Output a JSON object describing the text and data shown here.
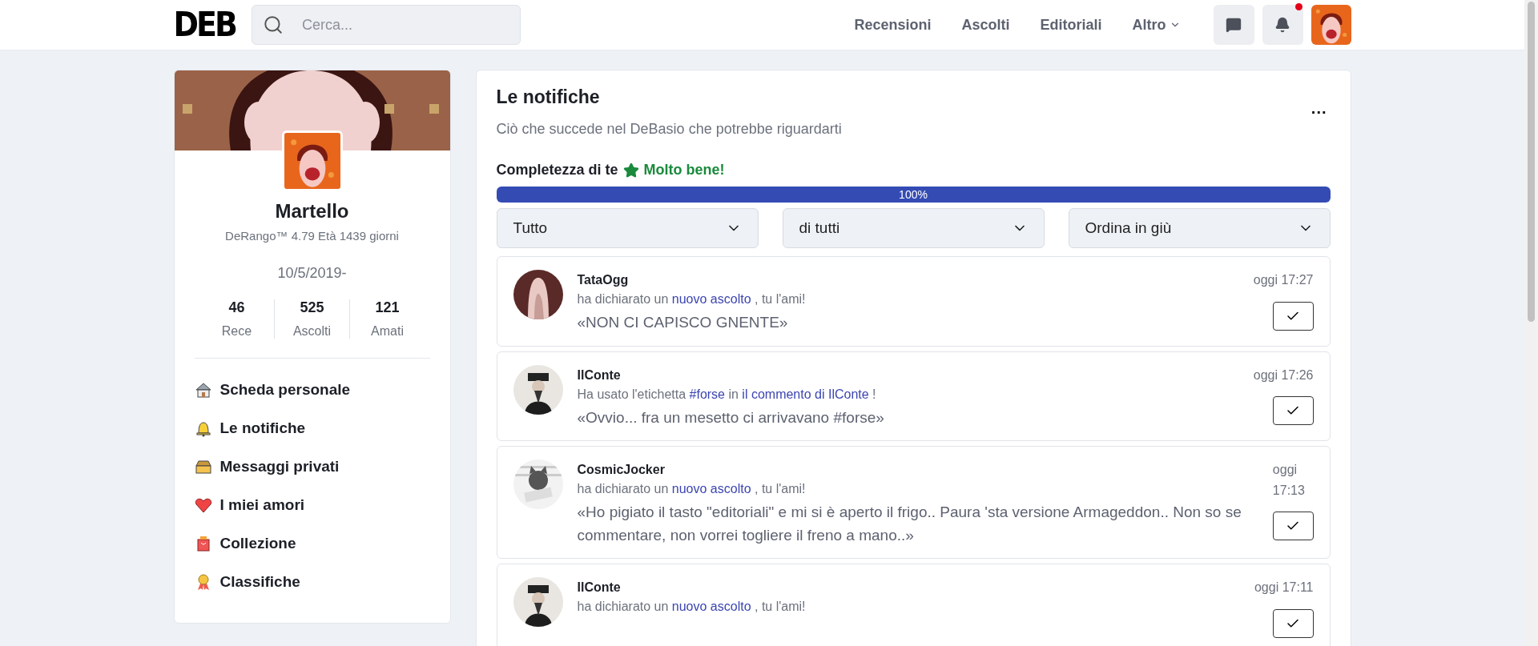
{
  "header": {
    "logo": "DEB",
    "search": {
      "placeholder": "Cerca..."
    },
    "nav": [
      {
        "label": "Recensioni",
        "dropdown": false
      },
      {
        "label": "Ascolti",
        "dropdown": false
      },
      {
        "label": "Editoriali",
        "dropdown": false
      },
      {
        "label": "Altro",
        "dropdown": true
      }
    ],
    "notifications_unread": true
  },
  "profile": {
    "name": "Martello",
    "subtitle": "DeRango™ 4.79 Età 1439 giorni",
    "date": "10/5/2019-",
    "stats": [
      {
        "value": "46",
        "label": "Rece"
      },
      {
        "value": "525",
        "label": "Ascolti"
      },
      {
        "value": "121",
        "label": "Amati"
      }
    ],
    "menu": [
      {
        "kind": "house",
        "label": "Scheda personale"
      },
      {
        "kind": "bell",
        "label": "Le notifiche"
      },
      {
        "kind": "inbox",
        "label": "Messaggi privati"
      },
      {
        "kind": "heart",
        "label": "I miei amori"
      },
      {
        "kind": "bag",
        "label": "Collezione"
      },
      {
        "kind": "medal",
        "label": "Classifiche"
      }
    ]
  },
  "panel": {
    "title": "Le notifiche",
    "subtitle": "Ciò che succede nel DeBasio che potrebbe riguardarti",
    "more": "...",
    "completeness": {
      "label": "Completezza di te",
      "status": "Molto bene!",
      "level": 1,
      "reading": "100%"
    },
    "filters": [
      {
        "value": "Tutto"
      },
      {
        "value": "di tutti"
      },
      {
        "value": "Ordina in giù"
      }
    ],
    "notifications": [
      {
        "user": "TataOgg",
        "time": "oggi 17:27",
        "action": [
          {
            "kind": "text",
            "text": "ha dichiarato un "
          },
          {
            "kind": "link",
            "text": "nuovo ascolto"
          },
          {
            "kind": "text",
            "text": " , tu l'ami!"
          }
        ],
        "quote": "«NON CI CAPISCO GNENTE»"
      },
      {
        "user": "IlConte",
        "time": "oggi 17:26",
        "action": [
          {
            "kind": "text",
            "text": "Ha usato l'etichetta "
          },
          {
            "kind": "link",
            "text": "#forse"
          },
          {
            "kind": "text",
            "text": " in "
          },
          {
            "kind": "link",
            "text": "il commento di IlConte"
          },
          {
            "kind": "text",
            "text": " !"
          }
        ],
        "quote": "«Ovvio... fra un mesetto ci arrivavano #forse»"
      },
      {
        "user": "CosmicJocker",
        "time": "oggi 17:13",
        "action": [
          {
            "kind": "text",
            "text": "ha dichiarato un "
          },
          {
            "kind": "link",
            "text": "nuovo ascolto"
          },
          {
            "kind": "text",
            "text": " , tu l'ami!"
          }
        ],
        "quote": "«Ho pigiato il tasto \"editoriali\" e mi si è aperto il frigo.. Paura 'sta versione Armageddon.. Non so se commentare, non vorrei togliere il freno a mano..»"
      },
      {
        "user": "IlConte",
        "time": "oggi 17:11",
        "action": [
          {
            "kind": "text",
            "text": "ha dichiarato un "
          },
          {
            "kind": "link",
            "text": "nuovo ascolto"
          },
          {
            "kind": "text",
            "text": " , tu l'ami!"
          }
        ]
      }
    ]
  }
}
